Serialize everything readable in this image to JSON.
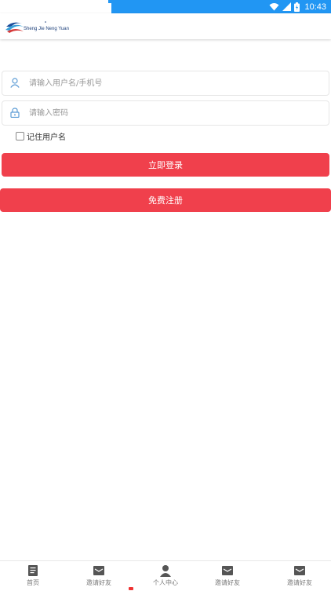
{
  "status_bar": {
    "time": "10:43"
  },
  "header": {
    "logo_text": "Sheng Jie Neng Yuan"
  },
  "login_form": {
    "username_placeholder": "请输入用户名/手机号",
    "password_placeholder": "请输入密码",
    "remember_label": "记住用户名",
    "remember_checked": false,
    "login_button": "立即登录",
    "register_button": "免费注册"
  },
  "tabbar": {
    "items": [
      {
        "label": "首页",
        "icon": "document-icon"
      },
      {
        "label": "邀请好友",
        "icon": "envelope-icon"
      },
      {
        "label": "个人中心",
        "icon": "person-icon"
      },
      {
        "label": "邀请好友",
        "icon": "envelope-icon"
      },
      {
        "label": "邀请好友",
        "icon": "envelope-icon"
      }
    ]
  },
  "colors": {
    "status_bar": "#2196f3",
    "button": "#f0404c",
    "icon_blue": "#5b9bd5"
  }
}
